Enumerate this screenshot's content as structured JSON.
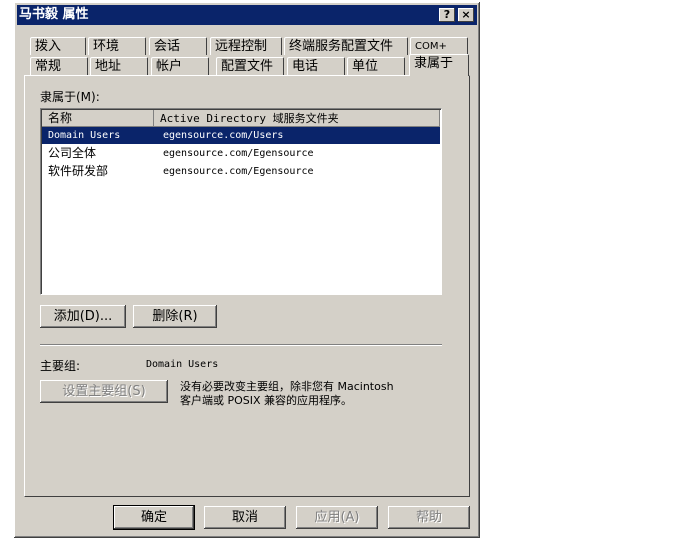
{
  "window": {
    "title": "马书毅 属性",
    "help_button": "?",
    "close_button": "×"
  },
  "tabs_top": [
    "拨入",
    "环境",
    "会话",
    "远程控制",
    "终端服务配置文件",
    "COM+"
  ],
  "tabs_bottom": [
    "常规",
    "地址",
    "帐户",
    "配置文件",
    "电话",
    "单位",
    "隶属于"
  ],
  "member_of": {
    "label": "隶属于(M):",
    "columns": [
      "名称",
      "Active Directory 域服务文件夹"
    ],
    "rows": [
      {
        "name": "Domain Users",
        "folder": "egensource.com/Users",
        "selected": true
      },
      {
        "name": "公司全体",
        "folder": "egensource.com/Egensource",
        "selected": false
      },
      {
        "name": "软件研发部",
        "folder": "egensource.com/Egensource",
        "selected": false
      }
    ],
    "add_button": "添加(D)...",
    "remove_button": "删除(R)"
  },
  "primary_group": {
    "label": "主要组:",
    "value": "Domain Users",
    "set_button": "设置主要组(S)",
    "note_line1": "没有必要改变主要组，除非您有 Macintosh",
    "note_line2": "客户端或 POSIX 兼容的应用程序。"
  },
  "dialog_buttons": {
    "ok": "确定",
    "cancel": "取消",
    "apply": "应用(A)",
    "help": "帮助"
  }
}
